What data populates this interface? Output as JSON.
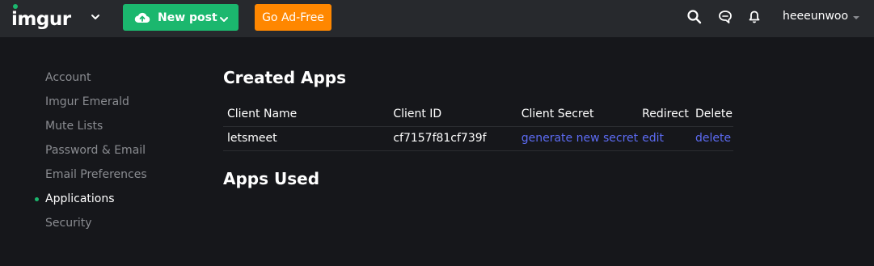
{
  "header": {
    "logo_text": "imgur",
    "new_post_label": "New post",
    "ad_free_label": "Go Ad-Free",
    "username": "heeeunwoo",
    "icons": [
      "search-icon",
      "chat-icon",
      "bell-icon"
    ],
    "colors": {
      "brand_green": "#1bb76e",
      "ad_free_orange": "#ff8700",
      "link_blue": "#5c6bf2"
    }
  },
  "sidebar": {
    "items": [
      {
        "label": "Account"
      },
      {
        "label": "Imgur Emerald"
      },
      {
        "label": "Mute Lists"
      },
      {
        "label": "Password & Email"
      },
      {
        "label": "Email Preferences"
      },
      {
        "label": "Applications",
        "active": true
      },
      {
        "label": "Security"
      }
    ]
  },
  "main": {
    "created_apps_title": "Created Apps",
    "apps_used_title": "Apps Used",
    "table": {
      "headers": [
        "Client Name",
        "Client ID",
        "Client Secret",
        "Redirect",
        "Delete"
      ],
      "rows": [
        {
          "client_name": "letsmeet",
          "client_id": "cf7157f81cf739f",
          "client_secret": "generate new secret",
          "redirect": "edit",
          "delete": "delete"
        }
      ]
    }
  }
}
